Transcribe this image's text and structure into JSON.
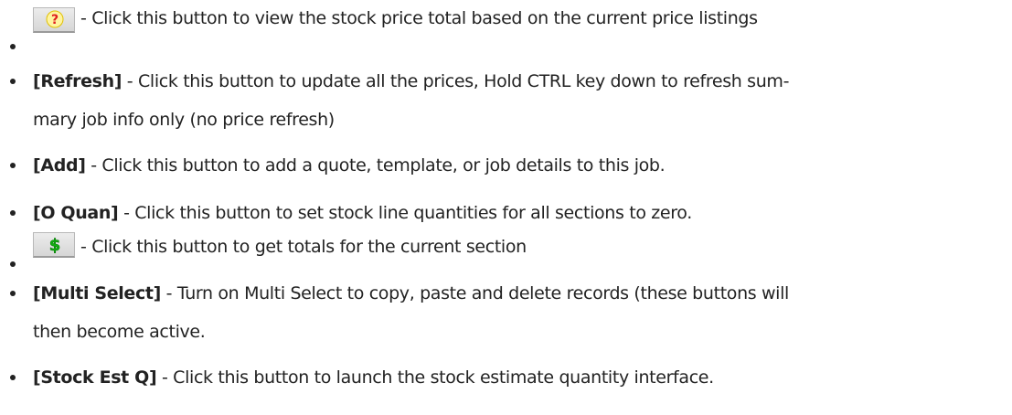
{
  "items": [
    {
      "icon": "help-question-icon",
      "text": "- Click this button to view the stock price total based on the current price listings"
    },
    {
      "label": "[Refresh]",
      "text": " - Click this button to update all the prices, Hold CTRL key down to refresh sum-",
      "text_cont": "mary job info only (no price refresh)"
    },
    {
      "label": "[Add]",
      "text": " - Click this button to add a quote, template, or job details to this job."
    },
    {
      "label": "[O Quan]",
      "text": " - Click this button to set stock line quantities for all sections to zero."
    },
    {
      "icon": "dollar-icon",
      "text": "- Click this button to get totals for the current section"
    },
    {
      "label": "[Multi Select]",
      "text": " - Turn on Multi Select to copy, paste and delete records (these buttons will",
      "text_cont": "then become active."
    },
    {
      "label": "[Stock Est Q]",
      "text": " - Click this button to launch the stock estimate quantity interface."
    }
  ]
}
